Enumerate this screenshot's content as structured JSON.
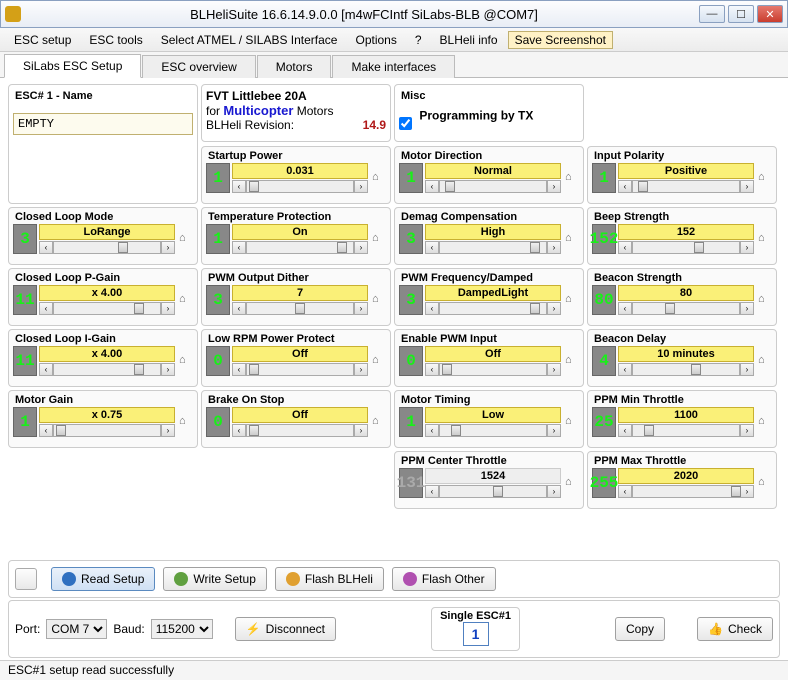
{
  "window": {
    "title": "BLHeliSuite 16.6.14.9.0.0   [m4wFCIntf SiLabs-BLB @COM7]"
  },
  "menu": {
    "esc_setup": "ESC setup",
    "esc_tools": "ESC tools",
    "select_interface": "Select ATMEL / SILABS Interface",
    "options": "Options",
    "help": "?",
    "blheli_info": "BLHeli info",
    "save_screenshot": "Save Screenshot"
  },
  "tabs": {
    "silabs": "SiLabs ESC Setup",
    "overview": "ESC overview",
    "motors": "Motors",
    "make": "Make interfaces"
  },
  "esc": {
    "header": "ESC# 1 - Name",
    "name_value": "EMPTY",
    "info_line1": "FVT Littlebee 20A",
    "info_for": "for",
    "info_mc": "Multicopter",
    "info_motors": "Motors",
    "info_rev_label": "BLHeli Revision:",
    "info_rev": "14.9",
    "misc_title": "Misc",
    "prog_by_tx": "Programming by TX"
  },
  "params": {
    "startup_power": {
      "label": "Startup Power",
      "num": "1",
      "val": "0.031"
    },
    "motor_direction": {
      "label": "Motor Direction",
      "num": "1",
      "val": "Normal"
    },
    "input_polarity": {
      "label": "Input Polarity",
      "num": "1",
      "val": "Positive"
    },
    "closed_loop_mode": {
      "label": "Closed Loop Mode",
      "num": "3",
      "val": "LoRange"
    },
    "temp_protection": {
      "label": "Temperature Protection",
      "num": "1",
      "val": "On"
    },
    "demag_comp": {
      "label": "Demag Compensation",
      "num": "3",
      "val": "High"
    },
    "beep_strength": {
      "label": "Beep Strength",
      "num": "152",
      "val": "152"
    },
    "closed_loop_p": {
      "label": "Closed Loop P-Gain",
      "num": "11",
      "val": "x 4.00"
    },
    "pwm_dither": {
      "label": "PWM Output Dither",
      "num": "3",
      "val": "7"
    },
    "pwm_freq": {
      "label": "PWM Frequency/Damped",
      "num": "3",
      "val": "DampedLight"
    },
    "beacon_strength": {
      "label": "Beacon Strength",
      "num": "80",
      "val": "80"
    },
    "closed_loop_i": {
      "label": "Closed Loop I-Gain",
      "num": "11",
      "val": "x 4.00"
    },
    "low_rpm_protect": {
      "label": "Low RPM Power Protect",
      "num": "0",
      "val": "Off"
    },
    "enable_pwm_input": {
      "label": "Enable PWM Input",
      "num": "0",
      "val": "Off"
    },
    "beacon_delay": {
      "label": "Beacon Delay",
      "num": "4",
      "val": "10 minutes"
    },
    "motor_gain": {
      "label": "Motor Gain",
      "num": "1",
      "val": "x 0.75"
    },
    "brake_on_stop": {
      "label": "Brake On Stop",
      "num": "0",
      "val": "Off"
    },
    "motor_timing": {
      "label": "Motor Timing",
      "num": "1",
      "val": "Low"
    },
    "ppm_min_throttle": {
      "label": "PPM Min Throttle",
      "num": "25",
      "val": "1100"
    },
    "ppm_center_throttle": {
      "label": "PPM Center Throttle",
      "num": "131",
      "val": "1524"
    },
    "ppm_max_throttle": {
      "label": "PPM Max Throttle",
      "num": "255",
      "val": "2020"
    }
  },
  "toolbar": {
    "read": "Read Setup",
    "write": "Write Setup",
    "flash_blheli": "Flash BLHeli",
    "flash_other": "Flash Other"
  },
  "bottom": {
    "port_label": "Port:",
    "port_value": "COM 7",
    "baud_label": "Baud:",
    "baud_value": "115200",
    "disconnect": "Disconnect",
    "single_esc_label": "Single ESC#1",
    "single_esc_num": "1",
    "copy": "Copy",
    "check": "Check"
  },
  "status": "ESC#1 setup read successfully"
}
